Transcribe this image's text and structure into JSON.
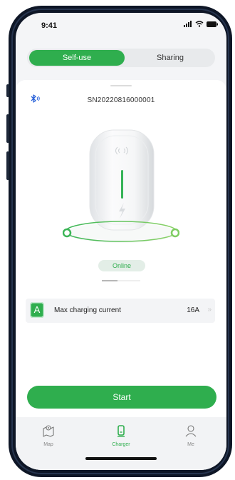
{
  "status_bar": {
    "time": "9:41"
  },
  "segment": {
    "self_use": "Self-use",
    "sharing": "Sharing"
  },
  "device": {
    "serial": "SN20220816000001",
    "status": "Online"
  },
  "setting": {
    "badge": "A",
    "label": "Max charging current",
    "value": "16A"
  },
  "actions": {
    "start": "Start"
  },
  "tabs": [
    {
      "label": "Map",
      "icon": "map-icon"
    },
    {
      "label": "Charger",
      "icon": "charger-icon"
    },
    {
      "label": "Me",
      "icon": "person-icon"
    }
  ],
  "colors": {
    "accent": "#2fae4e",
    "frame": "#0e1626",
    "background": "#f4f5f7"
  }
}
